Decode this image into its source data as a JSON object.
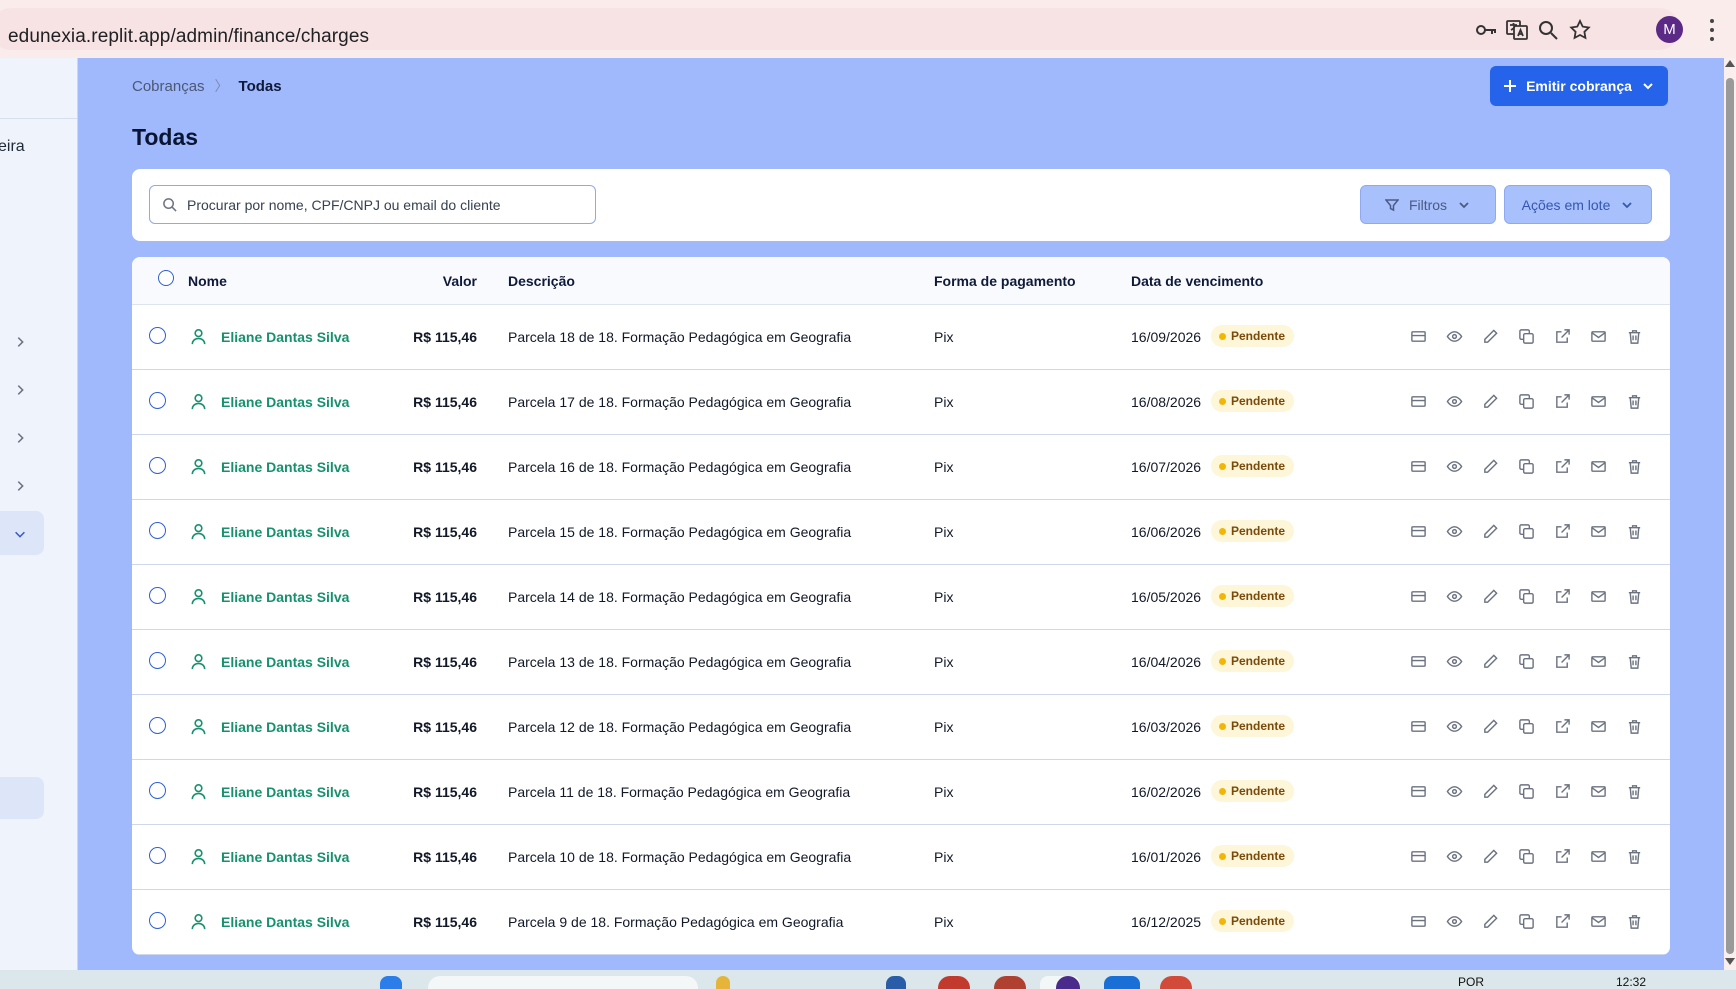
{
  "browser": {
    "url": "edunexia.replit.app/admin/finance/charges",
    "avatar_letter": "M"
  },
  "sidebar": {
    "partial_label": "eira",
    "partial_sub": "",
    "chevrons": [
      "right",
      "right",
      "right",
      "right",
      "down"
    ]
  },
  "breadcrumb": {
    "parent": "Cobranças",
    "current": "Todas"
  },
  "header": {
    "emit_button": "Emitir cobrança",
    "title": "Todas"
  },
  "filters": {
    "search_placeholder": "Procurar por nome, CPF/CNPJ ou email do cliente",
    "filtros_label": "Filtros",
    "acoes_label": "Ações em lote"
  },
  "table": {
    "columns": {
      "nome": "Nome",
      "valor": "Valor",
      "descricao": "Descrição",
      "forma": "Forma de pagamento",
      "vencimento": "Data de vencimento"
    },
    "rows": [
      {
        "name": "Eliane Dantas Silva",
        "valor": "R$ 115,46",
        "desc": "Parcela 18 de 18. Formação Pedagógica em Geografia",
        "forma": "Pix",
        "date": "16/09/2026",
        "status": "Pendente"
      },
      {
        "name": "Eliane Dantas Silva",
        "valor": "R$ 115,46",
        "desc": "Parcela 17 de 18. Formação Pedagógica em Geografia",
        "forma": "Pix",
        "date": "16/08/2026",
        "status": "Pendente"
      },
      {
        "name": "Eliane Dantas Silva",
        "valor": "R$ 115,46",
        "desc": "Parcela 16 de 18. Formação Pedagógica em Geografia",
        "forma": "Pix",
        "date": "16/07/2026",
        "status": "Pendente"
      },
      {
        "name": "Eliane Dantas Silva",
        "valor": "R$ 115,46",
        "desc": "Parcela 15 de 18. Formação Pedagógica em Geografia",
        "forma": "Pix",
        "date": "16/06/2026",
        "status": "Pendente"
      },
      {
        "name": "Eliane Dantas Silva",
        "valor": "R$ 115,46",
        "desc": "Parcela 14 de 18. Formação Pedagógica em Geografia",
        "forma": "Pix",
        "date": "16/05/2026",
        "status": "Pendente"
      },
      {
        "name": "Eliane Dantas Silva",
        "valor": "R$ 115,46",
        "desc": "Parcela 13 de 18. Formação Pedagógica em Geografia",
        "forma": "Pix",
        "date": "16/04/2026",
        "status": "Pendente"
      },
      {
        "name": "Eliane Dantas Silva",
        "valor": "R$ 115,46",
        "desc": "Parcela 12 de 18. Formação Pedagógica em Geografia",
        "forma": "Pix",
        "date": "16/03/2026",
        "status": "Pendente"
      },
      {
        "name": "Eliane Dantas Silva",
        "valor": "R$ 115,46",
        "desc": "Parcela 11 de 18. Formação Pedagógica em Geografia",
        "forma": "Pix",
        "date": "16/02/2026",
        "status": "Pendente"
      },
      {
        "name": "Eliane Dantas Silva",
        "valor": "R$ 115,46",
        "desc": "Parcela 10 de 18. Formação Pedagógica em Geografia",
        "forma": "Pix",
        "date": "16/01/2026",
        "status": "Pendente"
      },
      {
        "name": "Eliane Dantas Silva",
        "valor": "R$ 115,46",
        "desc": "Parcela 9 de 18. Formação Pedagógica em Geografia",
        "forma": "Pix",
        "date": "16/12/2025",
        "status": "Pendente"
      }
    ],
    "row_actions": [
      "card-icon",
      "eye-icon",
      "pencil-icon",
      "copy-icon",
      "external-link-icon",
      "mail-icon",
      "trash-icon"
    ]
  },
  "taskbar": {
    "lang": "POR",
    "time": "12:32"
  },
  "colors": {
    "page_bg": "#a0b8fc",
    "primary": "#2563eb",
    "name_green": "#16906d",
    "pending_dot": "#f2b705"
  }
}
